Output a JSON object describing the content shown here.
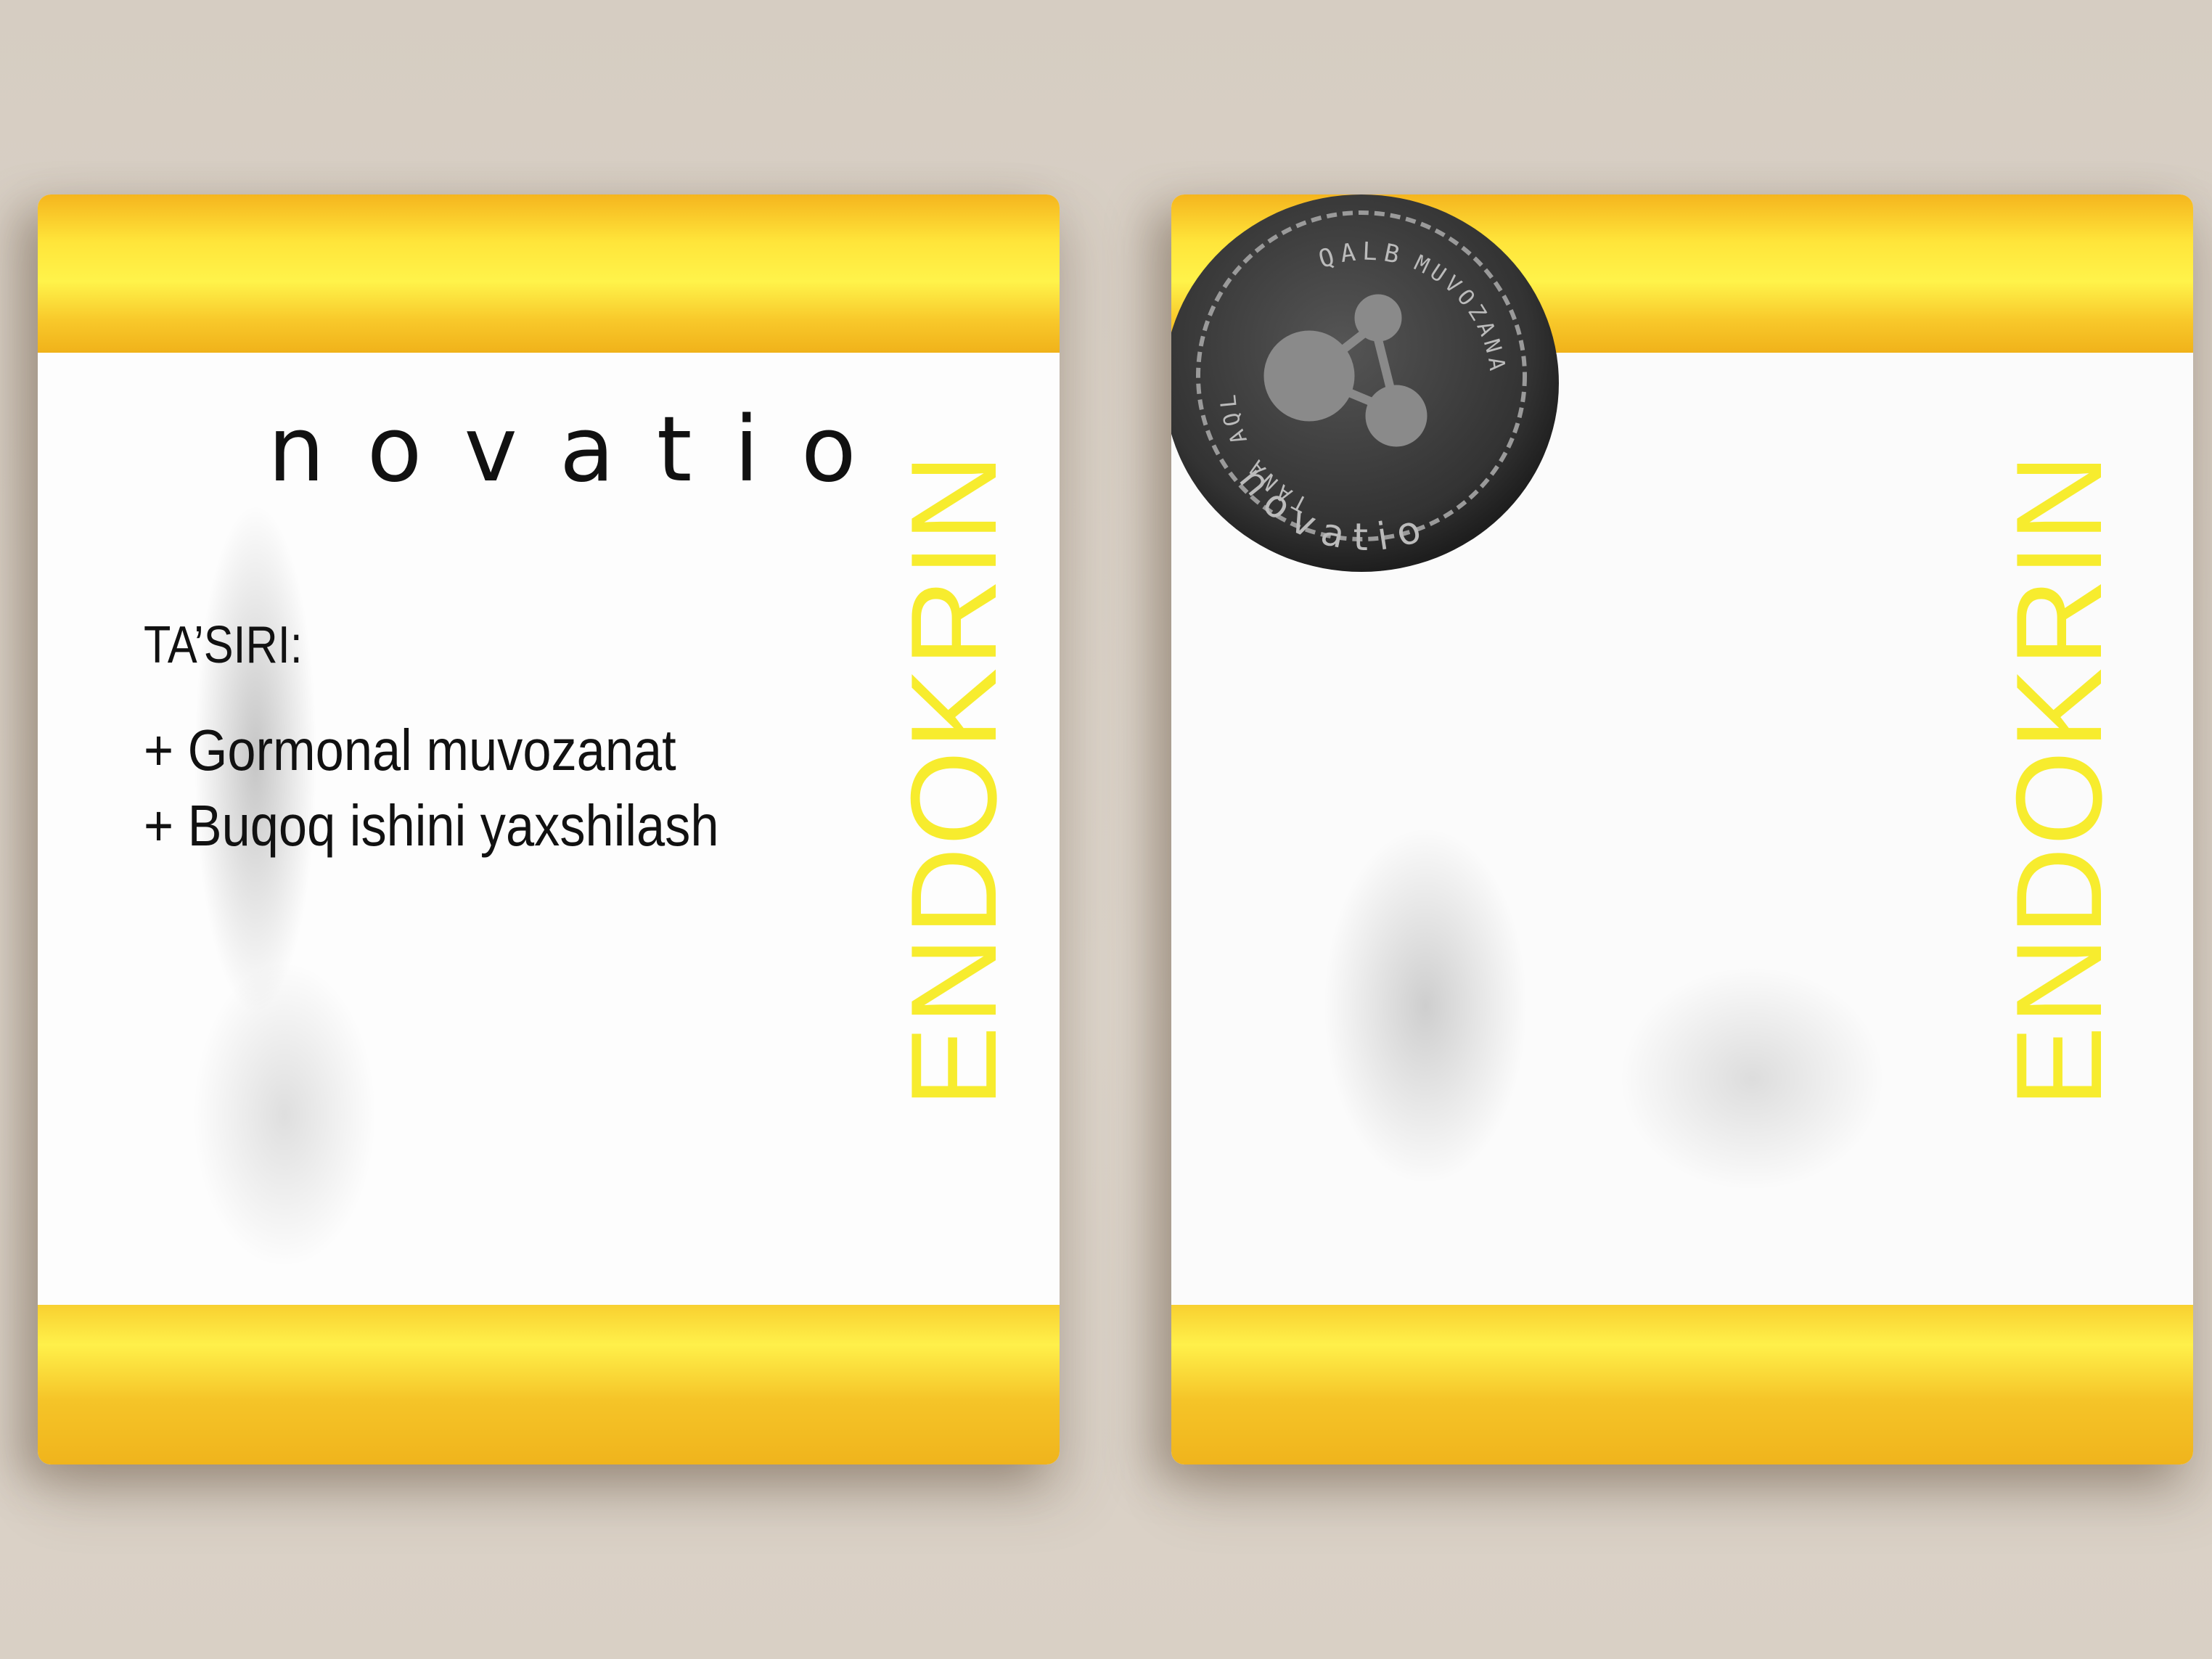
{
  "front": {
    "brand": "novatio",
    "effects_title": "TA’SIRI:",
    "effects": [
      "+ Gormonal muvozanat",
      "+ Buqoq ishini yaxshilash"
    ],
    "product_name": "ENDOKRIN"
  },
  "back": {
    "product_name": "ENDOKRIN",
    "seal": {
      "top_text": "QALB",
      "right_text": "MUVOZANATI",
      "left_text": "TANA AQL",
      "bottom_text": "novatio",
      "icon": "molecule-icon"
    }
  },
  "colors": {
    "accent_yellow": "#f7ec2e",
    "band_yellow": "#ffe53a",
    "background": "#d8cfc4",
    "seal": "#3a3a3a"
  }
}
